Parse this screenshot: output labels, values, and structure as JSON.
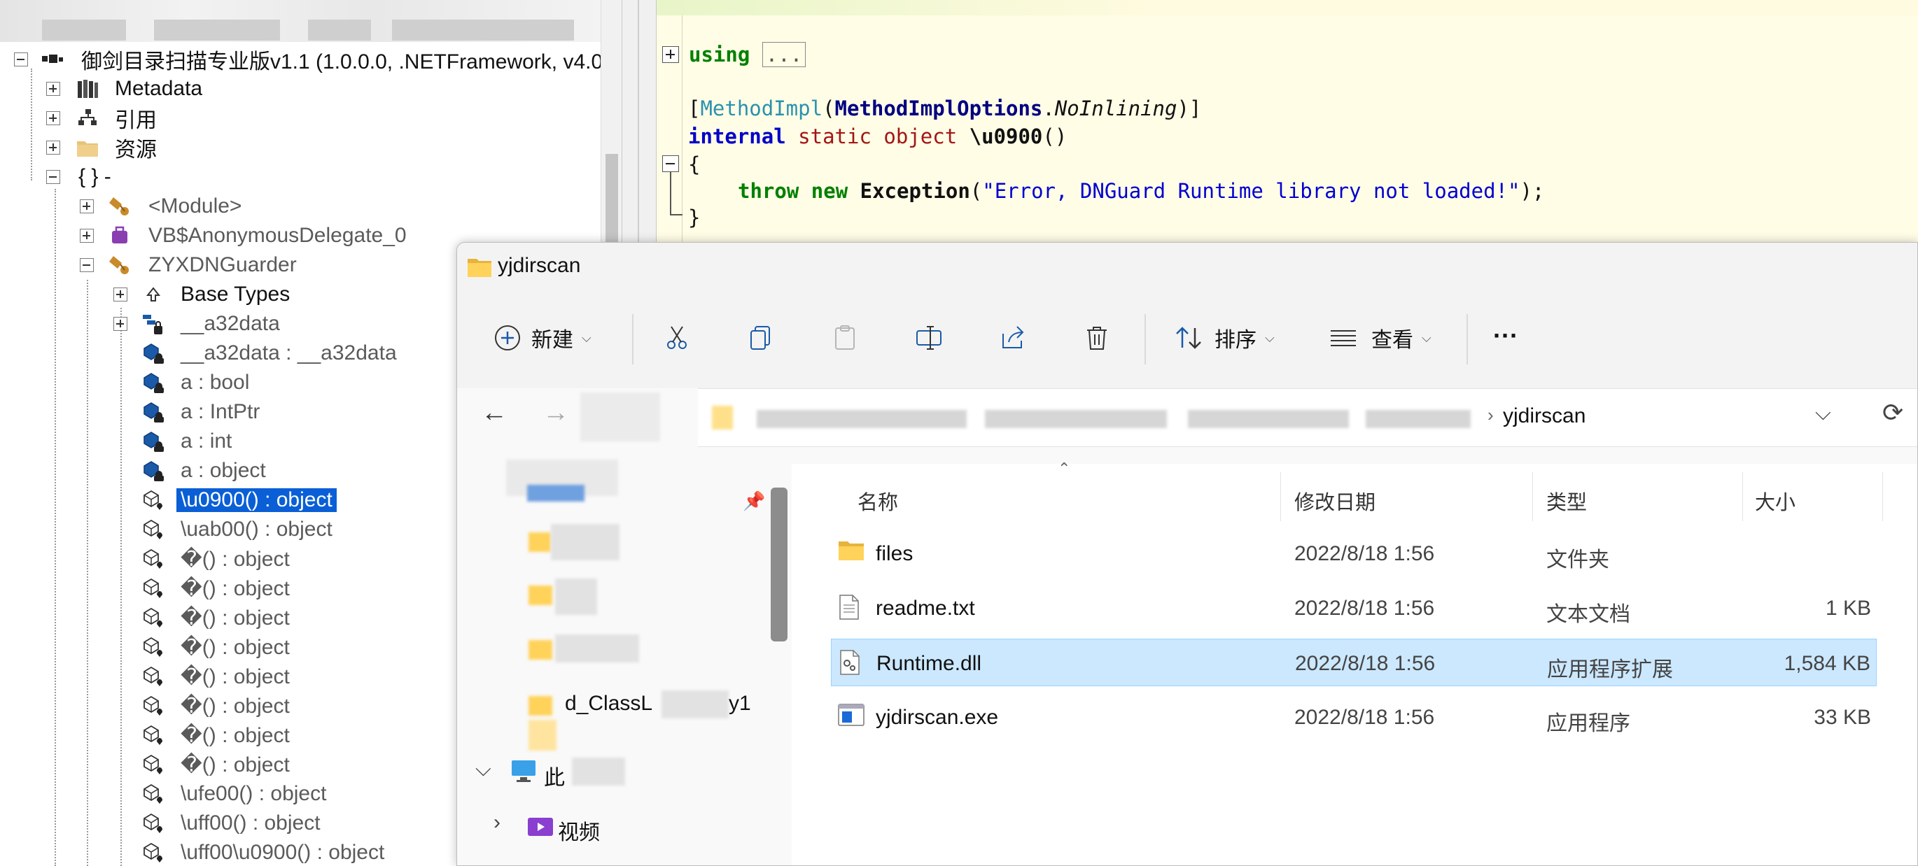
{
  "tree": {
    "root_label": "御剑目录扫描专业版v1.1 (1.0.0.0, .NETFramework, v4.0",
    "metadata": "Metadata",
    "references": "引用",
    "resources": "资源",
    "namespace": "{ }  -",
    "module": "<Module>",
    "anon_delegate": "VB$AnonymousDelegate_0",
    "class_name": "ZYXDNGuarder",
    "base_types": "Base Types",
    "nested_class": "__a32data",
    "members": [
      "__a32data : __a32data",
      "a : bool",
      "a : IntPtr",
      "a : int",
      "a : object",
      "\\u0900() : object",
      "\\uab00() : object",
      "�() : object",
      "�() : object",
      "�() : object",
      "�() : object",
      "�() : object",
      "�() : object",
      "�() : object",
      "�() : object",
      "\\ufe00() : object",
      "\\uff00() : object",
      "\\uff00\\u0900() : object"
    ]
  },
  "code": {
    "using": "using",
    "ellipsis": "...",
    "attr_open": "[",
    "attr_type": "MethodImpl",
    "attr_paren": "(",
    "attr_arg_type": "MethodImplOptions",
    "attr_dot": ".",
    "attr_arg_val": "NoInlining",
    "attr_close": ")]",
    "kw_internal": "internal",
    "kw_static": "static",
    "kw_object": "object",
    "method_name": "\\u0900",
    "parens": "()",
    "brace_open": "{",
    "kw_throw": "throw",
    "kw_new": "new",
    "exception_type": "Exception",
    "call_open": "(",
    "message": "\"Error, DNGuard Runtime library not loaded!\"",
    "call_close": ");",
    "brace_close": "}"
  },
  "explorer": {
    "title": "yjdirscan",
    "toolbar": {
      "new_label": "新建",
      "sort_label": "排序",
      "view_label": "查看",
      "more_label": "···"
    },
    "address_current": "yjdirscan",
    "nav_items": [
      "d_ClassL",
      "y1",
      "此",
      "视频"
    ],
    "columns": {
      "name": "名称",
      "date": "修改日期",
      "type": "类型",
      "size": "大小"
    },
    "files": [
      {
        "name": "files",
        "date": "2022/8/18 1:56",
        "type": "文件夹",
        "size": ""
      },
      {
        "name": "readme.txt",
        "date": "2022/8/18 1:56",
        "type": "文本文档",
        "size": "1 KB"
      },
      {
        "name": "Runtime.dll",
        "date": "2022/8/18 1:56",
        "type": "应用程序扩展",
        "size": "1,584 KB"
      },
      {
        "name": "yjdirscan.exe",
        "date": "2022/8/18 1:56",
        "type": "应用程序",
        "size": "33 KB"
      }
    ],
    "selected_file_index": 2,
    "colors": {
      "selection": "#cce8ff",
      "tree_selection": "#0a5fd6"
    }
  }
}
